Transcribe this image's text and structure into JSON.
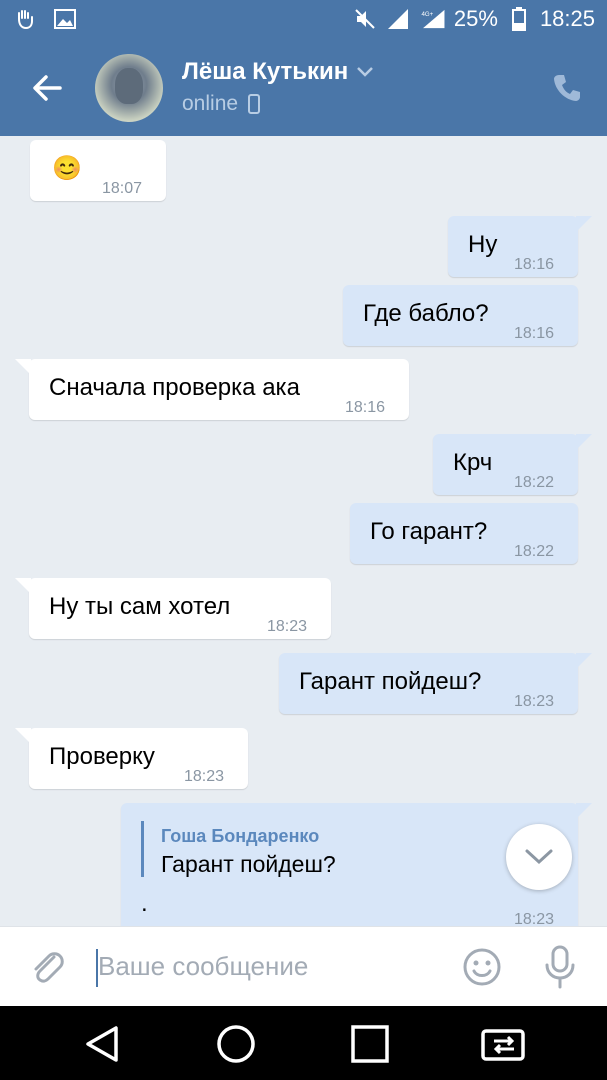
{
  "status_bar": {
    "battery": "25%",
    "time": "18:25",
    "network": "4G+",
    "icons": [
      "hand-icon",
      "image-icon",
      "mute-icon",
      "signal-icon",
      "battery-icon"
    ]
  },
  "header": {
    "name": "Лёша Кутькин",
    "status": "online",
    "accent": "#4a76a8"
  },
  "messages": [
    {
      "dir": "in",
      "text": "😊",
      "time": "18:07"
    },
    {
      "dir": "out",
      "text": "Ну",
      "time": "18:16"
    },
    {
      "dir": "out",
      "text": "Где бабло?",
      "time": "18:16"
    },
    {
      "dir": "in",
      "text": "Сначала проверка ака",
      "time": "18:16"
    },
    {
      "dir": "out",
      "text": "Крч",
      "time": "18:22"
    },
    {
      "dir": "out",
      "text": "Го гарант?",
      "time": "18:22"
    },
    {
      "dir": "in",
      "text": "Ну ты сам хотел",
      "time": "18:23"
    },
    {
      "dir": "out",
      "text": "Гарант пойдеш?",
      "time": "18:23"
    },
    {
      "dir": "in",
      "text": "Проверку",
      "time": "18:23"
    },
    {
      "dir": "out",
      "reply_author": "Гоша Бондаренко",
      "reply_text": "Гарант пойдеш?",
      "text": ".",
      "time": "18:23"
    }
  ],
  "composer": {
    "placeholder": "Ваше сообщение"
  }
}
